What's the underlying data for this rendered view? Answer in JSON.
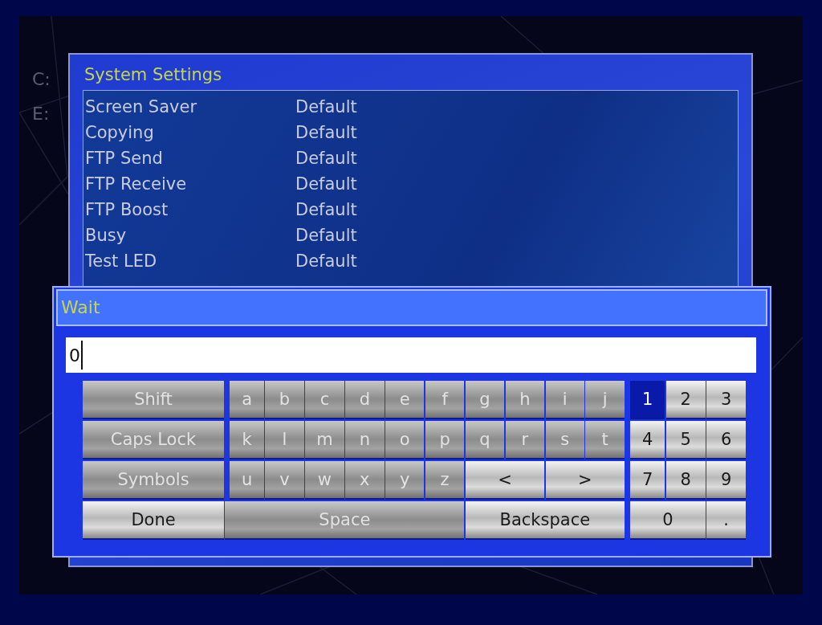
{
  "background_labels": [
    "C:",
    "E:"
  ],
  "settings": {
    "title": "System Settings",
    "rows": [
      {
        "name": "Screen Saver",
        "value": "Default"
      },
      {
        "name": "Copying",
        "value": "Default"
      },
      {
        "name": "FTP Send",
        "value": "Default"
      },
      {
        "name": "FTP Receive",
        "value": "Default"
      },
      {
        "name": "FTP Boost",
        "value": "Default"
      },
      {
        "name": "Busy",
        "value": "Default"
      },
      {
        "name": "Test LED",
        "value": "Default"
      }
    ]
  },
  "keyboard": {
    "title": "Wait",
    "input": {
      "value": "0"
    },
    "keys": [
      {
        "label": "Shift",
        "kind": "wide",
        "disabled": true,
        "selected": false
      },
      {
        "label": "a",
        "kind": "letter",
        "disabled": true,
        "selected": false
      },
      {
        "label": "b",
        "kind": "letter",
        "disabled": true,
        "selected": false
      },
      {
        "label": "c",
        "kind": "letter",
        "disabled": true,
        "selected": false
      },
      {
        "label": "d",
        "kind": "letter",
        "disabled": true,
        "selected": false
      },
      {
        "label": "e",
        "kind": "letter",
        "disabled": true,
        "selected": false
      },
      {
        "label": "f",
        "kind": "letter",
        "disabled": true,
        "selected": false
      },
      {
        "label": "g",
        "kind": "letter",
        "disabled": true,
        "selected": false
      },
      {
        "label": "h",
        "kind": "letter",
        "disabled": true,
        "selected": false
      },
      {
        "label": "i",
        "kind": "letter",
        "disabled": true,
        "selected": false
      },
      {
        "label": "j",
        "kind": "letter",
        "disabled": true,
        "selected": false
      },
      {
        "label": "1",
        "kind": "digit",
        "disabled": false,
        "selected": true
      },
      {
        "label": "2",
        "kind": "digit",
        "disabled": false,
        "selected": false
      },
      {
        "label": "3",
        "kind": "digit",
        "disabled": false,
        "selected": false
      },
      {
        "label": "Caps Lock",
        "kind": "wide",
        "disabled": true,
        "selected": false
      },
      {
        "label": "k",
        "kind": "letter",
        "disabled": true,
        "selected": false
      },
      {
        "label": "l",
        "kind": "letter",
        "disabled": true,
        "selected": false
      },
      {
        "label": "m",
        "kind": "letter",
        "disabled": true,
        "selected": false
      },
      {
        "label": "n",
        "kind": "letter",
        "disabled": true,
        "selected": false
      },
      {
        "label": "o",
        "kind": "letter",
        "disabled": true,
        "selected": false
      },
      {
        "label": "p",
        "kind": "letter",
        "disabled": true,
        "selected": false
      },
      {
        "label": "q",
        "kind": "letter",
        "disabled": true,
        "selected": false
      },
      {
        "label": "r",
        "kind": "letter",
        "disabled": true,
        "selected": false
      },
      {
        "label": "s",
        "kind": "letter",
        "disabled": true,
        "selected": false
      },
      {
        "label": "t",
        "kind": "letter",
        "disabled": true,
        "selected": false
      },
      {
        "label": "4",
        "kind": "digit",
        "disabled": false,
        "selected": false
      },
      {
        "label": "5",
        "kind": "digit",
        "disabled": false,
        "selected": false
      },
      {
        "label": "6",
        "kind": "digit",
        "disabled": false,
        "selected": false
      },
      {
        "label": "Symbols",
        "kind": "wide",
        "disabled": true,
        "selected": false
      },
      {
        "label": "u",
        "kind": "letter",
        "disabled": true,
        "selected": false
      },
      {
        "label": "v",
        "kind": "letter",
        "disabled": true,
        "selected": false
      },
      {
        "label": "w",
        "kind": "letter",
        "disabled": true,
        "selected": false
      },
      {
        "label": "x",
        "kind": "letter",
        "disabled": true,
        "selected": false
      },
      {
        "label": "y",
        "kind": "letter",
        "disabled": true,
        "selected": false
      },
      {
        "label": "z",
        "kind": "letter",
        "disabled": true,
        "selected": false
      },
      {
        "label": "<",
        "kind": "arrow",
        "disabled": false,
        "selected": false
      },
      {
        "label": ">",
        "kind": "arrow",
        "disabled": false,
        "selected": false
      },
      {
        "label": "7",
        "kind": "digit",
        "disabled": false,
        "selected": false
      },
      {
        "label": "8",
        "kind": "digit",
        "disabled": false,
        "selected": false
      },
      {
        "label": "9",
        "kind": "digit",
        "disabled": false,
        "selected": false
      },
      {
        "label": "Done",
        "kind": "wide",
        "disabled": false,
        "selected": false
      },
      {
        "label": "Space",
        "kind": "space",
        "disabled": true,
        "selected": false
      },
      {
        "label": "Backspace",
        "kind": "backspace",
        "disabled": false,
        "selected": false
      },
      {
        "label": "0",
        "kind": "zero",
        "disabled": false,
        "selected": false
      },
      {
        "label": ".",
        "kind": "digit",
        "disabled": false,
        "selected": false
      }
    ]
  }
}
